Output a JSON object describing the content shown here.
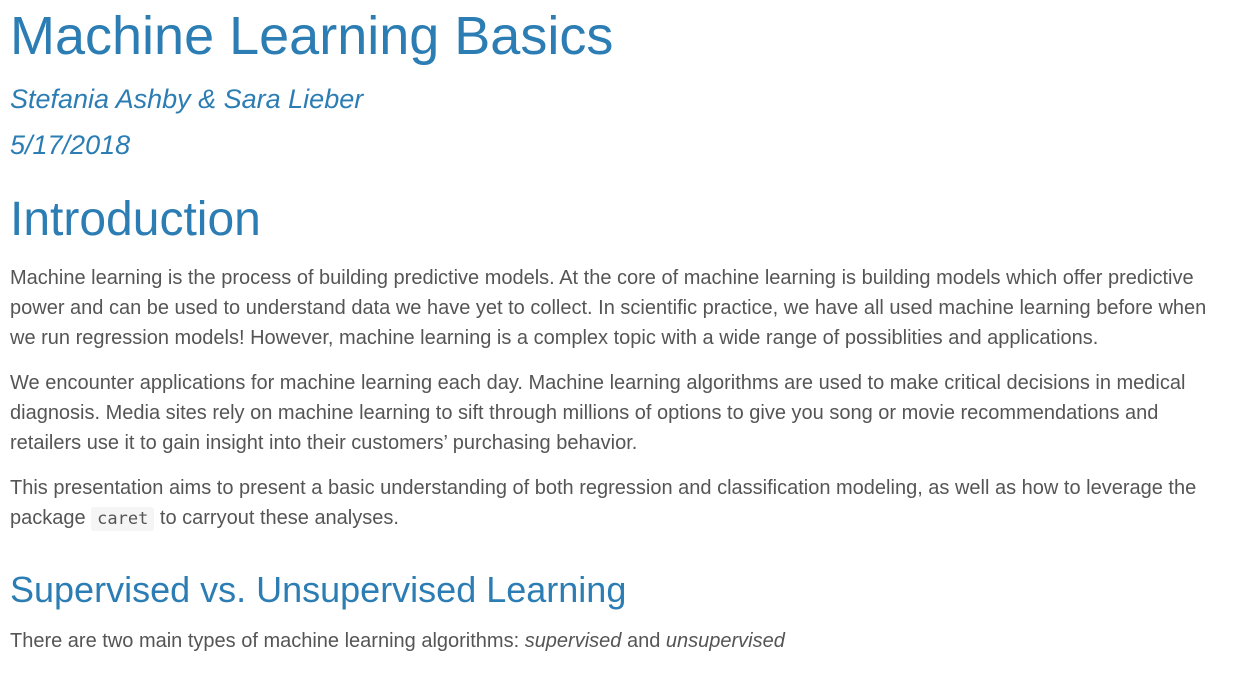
{
  "title": "Machine Learning Basics",
  "author": "Stefania Ashby & Sara Lieber",
  "date": "5/17/2018",
  "introduction": {
    "heading": "Introduction",
    "paragraph1": "Machine learning is the process of building predictive models. At the core of machine learning is building models which offer predictive power and can be used to understand data we have yet to collect. In scientific practice, we have all used machine learning before when we run regression models! However, machine learning is a complex topic with a wide range of possiblities and applications.",
    "paragraph2": "We encounter applications for machine learning each day. Machine learning algorithms are used to make critical decisions in medical diagnosis. Media sites rely on machine learning to sift through millions of options to give you song or movie recommendations and retailers use it to gain insight into their customers’ purchasing behavior.",
    "paragraph3_before": "This presentation aims to present a basic understanding of both regression and classification modeling, as well as how to leverage the package ",
    "paragraph3_code": "caret",
    "paragraph3_after": " to carryout these analyses."
  },
  "supervised_section": {
    "heading": "Supervised vs. Unsupervised Learning",
    "text_before": "There are two main types of machine learning algorithms: ",
    "term1": "supervised",
    "text_middle": " and ",
    "term2": "unsupervised"
  },
  "colors": {
    "heading": "#2b7db3",
    "body_text": "#555555",
    "code_background": "#f5f5f5"
  }
}
